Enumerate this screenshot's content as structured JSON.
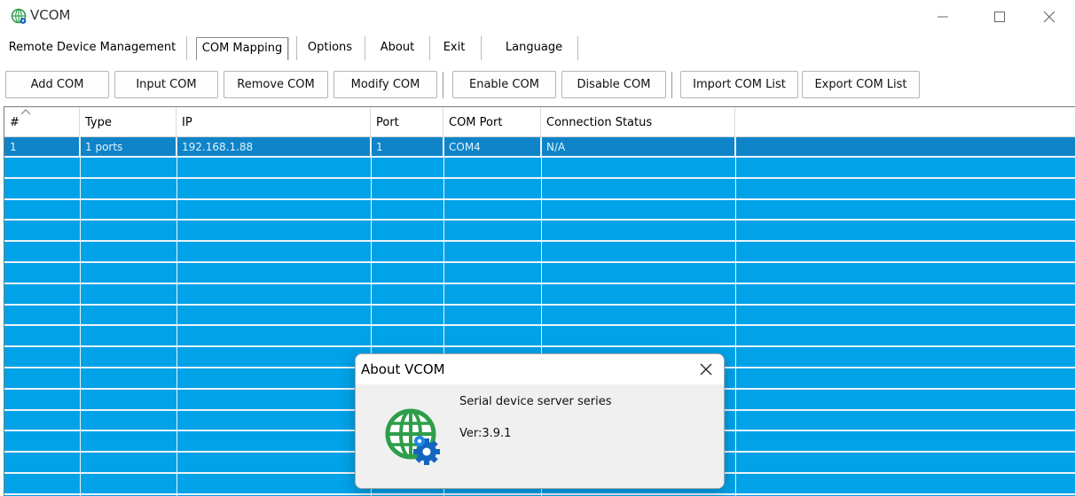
{
  "window": {
    "title": "VCOM"
  },
  "tabs": [
    {
      "label": "Remote Device Management"
    },
    {
      "label": "COM Mapping",
      "active": true
    },
    {
      "label": "Options"
    },
    {
      "label": "About"
    },
    {
      "label": "Exit"
    },
    {
      "label": "Language"
    }
  ],
  "toolbar": {
    "add_com": "Add COM",
    "input_com": "Input COM",
    "remove_com": "Remove COM",
    "modify_com": "Modify COM",
    "enable_com": "Enable COM",
    "disable_com": "Disable COM",
    "import_com_list": "Import COM List",
    "export_com_list": "Export COM List"
  },
  "table": {
    "columns": [
      "#",
      "Type",
      "IP",
      "Port",
      "COM Port",
      "Connection Status"
    ],
    "rows": [
      {
        "num": "1",
        "type": "1 ports",
        "ip": "192.168.1.88",
        "port": "1",
        "com_port": "COM4",
        "status": "N/A",
        "selected": true
      }
    ]
  },
  "about_dialog": {
    "title": "About VCOM",
    "line1": "Serial device server series",
    "version": "Ver:3.9.1"
  },
  "colors": {
    "grid_bg": "#00a2e8",
    "selected_row": "#0f84c8",
    "icon_green": "#2e9e4a",
    "gear_blue": "#1565c0"
  },
  "icons": {
    "app": "globe-gear-icon",
    "minimize": "minimize-icon",
    "maximize": "maximize-icon",
    "close": "close-icon",
    "sort": "sort-up-icon",
    "dialog_close": "close-icon",
    "dialog_logo": "globe-gear-icon"
  }
}
